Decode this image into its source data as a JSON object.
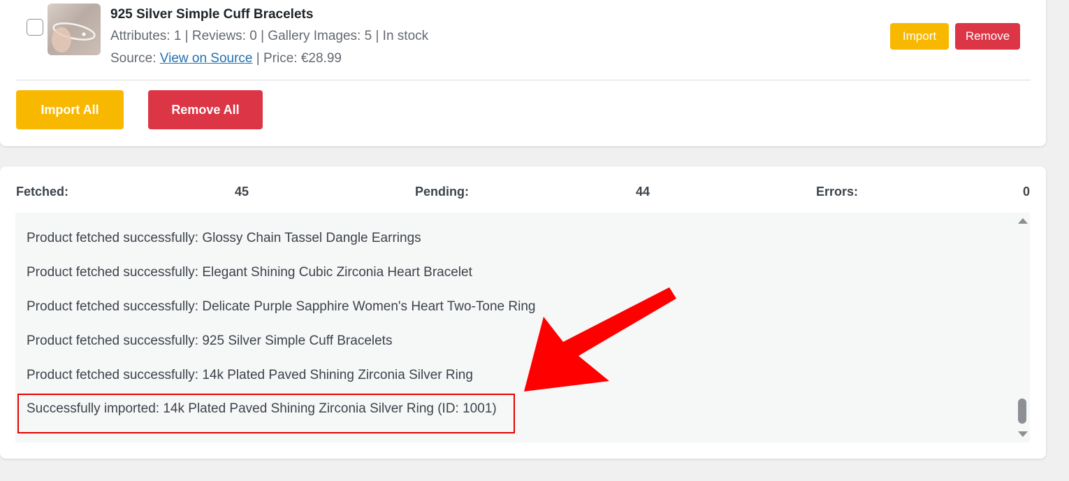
{
  "product": {
    "title": "925 Silver Simple Cuff Bracelets",
    "meta": "Attributes: 1 | Reviews: 0 | Gallery Images: 5 | In stock",
    "source_prefix": "Source: ",
    "source_link": "View on Source",
    "price_text": " | Price: €28.99",
    "import_label": "Import",
    "remove_label": "Remove"
  },
  "bulk_actions": {
    "import_all_label": "Import All",
    "remove_all_label": "Remove All"
  },
  "stats": {
    "fetched_label": "Fetched:",
    "fetched_value": "45",
    "pending_label": "Pending:",
    "pending_value": "44",
    "errors_label": "Errors:",
    "errors_value": "0"
  },
  "log": {
    "lines": [
      "Product fetched successfully: Glossy Chain Tassel Dangle Earrings",
      "Product fetched successfully: Elegant Shining Cubic Zirconia Heart Bracelet",
      "Product fetched successfully: Delicate Purple Sapphire Women's Heart Two-Tone Ring",
      "Product fetched successfully: 925 Silver Simple Cuff Bracelets",
      "Product fetched successfully: 14k Plated Paved Shining Zirconia Silver Ring",
      "Successfully imported: 14k Plated Paved Shining Zirconia Silver Ring (ID: 1001)"
    ]
  },
  "colors": {
    "import": "#f9b800",
    "remove": "#dc3545",
    "link": "#2271b1",
    "annotation": "#e60000"
  },
  "icons": {
    "annotation": "red-arrow-icon"
  }
}
